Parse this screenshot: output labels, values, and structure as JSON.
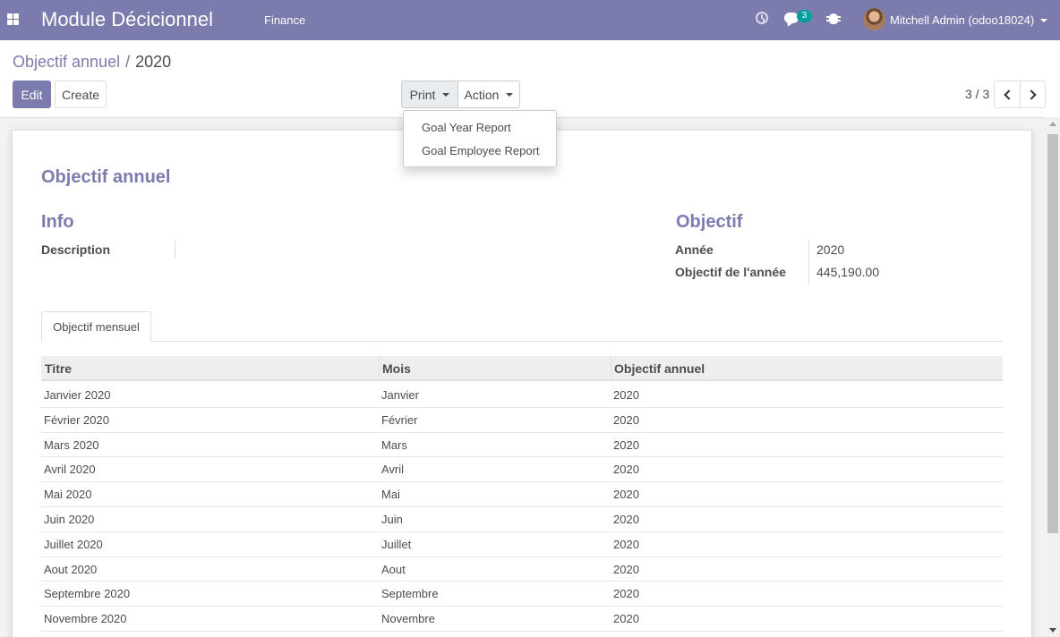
{
  "navbar": {
    "app_title": "Module Décicionnel",
    "menu": "Finance",
    "messages_badge": "3",
    "user": "Mitchell Admin (odoo18024)"
  },
  "breadcrumb": {
    "parent": "Objectif annuel",
    "separator": "/",
    "current": "2020"
  },
  "buttons": {
    "edit": "Edit",
    "create": "Create",
    "print": "Print",
    "action": "Action"
  },
  "pager": {
    "value": "3 / 3"
  },
  "print_menu": [
    "Goal Year Report",
    "Goal Employee Report"
  ],
  "form": {
    "title": "Objectif annuel",
    "info": {
      "heading": "Info",
      "description_label": "Description",
      "description_value": ""
    },
    "objectif": {
      "heading": "Objectif",
      "year_label": "Année",
      "year_value": "2020",
      "goal_label": "Objectif de l'année",
      "goal_value": "445,190.00"
    },
    "tab": "Objectif mensuel",
    "table": {
      "columns": [
        "Titre",
        "Mois",
        "Objectif annuel"
      ],
      "rows": [
        [
          "Janvier 2020",
          "Janvier",
          "2020"
        ],
        [
          "Février 2020",
          "Février",
          "2020"
        ],
        [
          "Mars 2020",
          "Mars",
          "2020"
        ],
        [
          "Avril 2020",
          "Avril",
          "2020"
        ],
        [
          "Mai 2020",
          "Mai",
          "2020"
        ],
        [
          "Juin 2020",
          "Juin",
          "2020"
        ],
        [
          "Juillet 2020",
          "Juillet",
          "2020"
        ],
        [
          "Aout 2020",
          "Aout",
          "2020"
        ],
        [
          "Septembre 2020",
          "Septembre",
          "2020"
        ],
        [
          "Novembre 2020",
          "Novembre",
          "2020"
        ]
      ]
    }
  },
  "colors": {
    "primary": "#7c7bad",
    "badge": "#00a09d",
    "text": "#4c4c4c"
  }
}
